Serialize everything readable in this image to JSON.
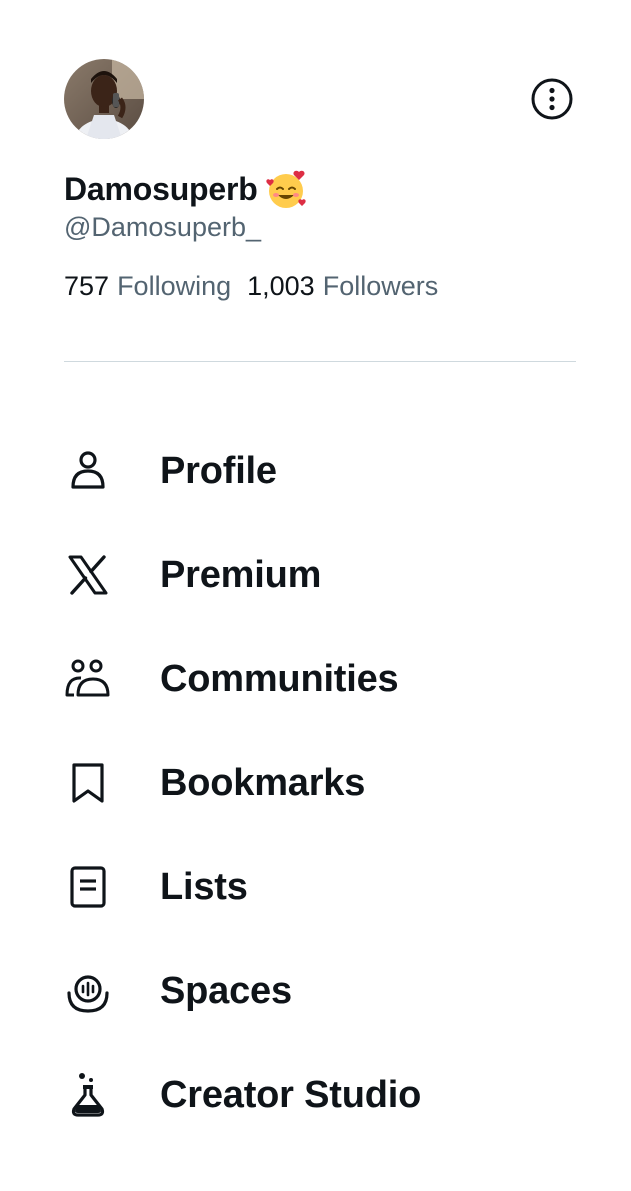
{
  "profile": {
    "avatar_alt": "Profile photo",
    "display_name": "Damosuperb",
    "name_emoji": "smiling-face-with-hearts",
    "handle": "@Damosuperb_",
    "following_count": "757",
    "following_label": "Following",
    "followers_count": "1,003",
    "followers_label": "Followers"
  },
  "actions": {
    "more_icon": "more-circle-icon"
  },
  "menu": {
    "items": [
      {
        "label": "Profile",
        "icon": "person-icon"
      },
      {
        "label": "Premium",
        "icon": "x-logo-icon"
      },
      {
        "label": "Communities",
        "icon": "communities-icon"
      },
      {
        "label": "Bookmarks",
        "icon": "bookmark-icon"
      },
      {
        "label": "Lists",
        "icon": "list-icon"
      },
      {
        "label": "Spaces",
        "icon": "spaces-icon"
      },
      {
        "label": "Creator Studio",
        "icon": "flask-icon"
      }
    ]
  },
  "colors": {
    "text_primary": "#0f1419",
    "text_secondary": "#536471",
    "divider": "#cfd9de",
    "background": "#ffffff"
  }
}
